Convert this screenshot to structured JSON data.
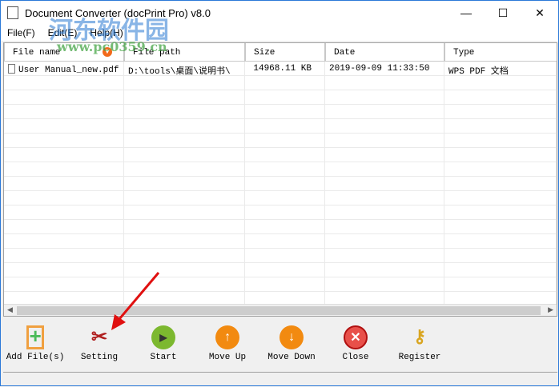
{
  "window": {
    "title": "Document Converter (docPrint Pro) v8.0",
    "minimize": "—",
    "maximize": "☐",
    "close": "✕"
  },
  "menu": [
    "File(F)",
    "Edit(E)",
    "Help(H)"
  ],
  "columns": [
    "File name",
    "File path",
    "Size",
    "Date",
    "Type"
  ],
  "rows": [
    {
      "name": "User Manual_new.pdf",
      "path": "D:\\tools\\桌面\\说明书\\",
      "size": "14968.11 KB",
      "date": "2019-09-09 11:33:50",
      "type": "WPS PDF 文档"
    }
  ],
  "toolbar": [
    {
      "label": "Add File(s)",
      "icon": "add-file-icon"
    },
    {
      "label": "Setting",
      "icon": "tools-icon"
    },
    {
      "label": "Start",
      "icon": "play-icon"
    },
    {
      "label": "Move Up",
      "icon": "arrow-up-icon"
    },
    {
      "label": "Move Down",
      "icon": "arrow-down-icon"
    },
    {
      "label": "Close",
      "icon": "close-circle-icon"
    },
    {
      "label": "Register",
      "icon": "keys-icon"
    }
  ],
  "watermark": {
    "text": "河东软件园",
    "url": "www.pc0359.cn"
  }
}
